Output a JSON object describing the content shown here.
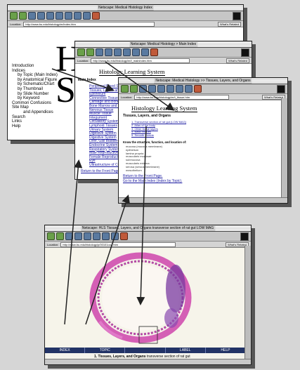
{
  "windows": {
    "index": {
      "title": "Netscape: Medical Histology Index",
      "location_label": "Location:",
      "url": "http://www.bu.edu/histology/m/index.htm",
      "whats_related": "What's Related",
      "big_letters": [
        "H",
        "S"
      ],
      "menu": [
        "Introduction",
        "Indices",
        "by Topic (Main Index)",
        "by Anatomical Figure",
        "by Schematic/Chart",
        "by Thumbnail",
        "by Slide Number",
        "by Keyword",
        "Common Confusions",
        "Site Map",
        "and Appendices",
        "Search",
        "Links",
        "Help"
      ]
    },
    "main_index": {
      "title": "Netscape: Medical Histology > Main Index",
      "location_label": "Location:",
      "url": "http://www.bu.edu/histology/m/t_mainindex.htm",
      "whats_related": "What's Related",
      "heading": "Histology Learning System",
      "subheading": "Main Index",
      "topics": [
        "Peripheral Blood Smear",
        "Tissues, Layers and Organs",
        "Epithelium",
        "Connective Tissue",
        "Cartilage and Bone",
        "Bone Marrow and Blood",
        "Nervous Tissue",
        "Muscle Tissue",
        "Integument",
        "Circulatory System",
        "Lymphoid Tissues",
        "Urinary System",
        "Digestive System",
        "Digestive System",
        "Liver, Gall Bladder",
        "Endocrine System",
        "Respiratory System",
        "Male Reproductive",
        "Female Reproductive",
        "Eye",
        "Ultrastructure of Cells"
      ],
      "return_link": "Return to the Front Page"
    },
    "tissues": {
      "title": "Netscape: Medical Histology >> Tissues, Layers, and Organs",
      "location_label": "Location:",
      "url": "http://www.bu.edu/histology/m/t_tissue.htm",
      "whats_related": "What's Related",
      "heading": "Histology Learning System",
      "subheading": "Tissues, Layers, and Organs",
      "list": [
        "1. Transverse section of rat gut (LOW MAG)",
        "2. Atlas of the body",
        "3. Other tissue layers",
        "4. Basic tissues",
        "5. Smooth muscle"
      ],
      "know_heading": "Know the structure, function, and location of:",
      "know_items": [
        "mucosa (mucous membrane)",
        "epithelium",
        "lamina propria",
        "muscularis mucosae",
        "submucosa",
        "muscularis externa",
        "serosa (serous membrane)",
        "mesothelium"
      ],
      "return_text": "Return to the Front Page.",
      "go_text": "Go to the Main Index (Index by Topic)."
    },
    "slide": {
      "title": "Netscape: HLS Tissues, Layers, and Organs transverse section of rat gut LOW MAG",
      "location_label": "Location:",
      "url": "http://www.bu.edu/histology/p/00101ooa.htm",
      "whats_related": "What's Related",
      "nav": [
        "INDEX",
        "TOPIC",
        "LABEL",
        "HELP"
      ],
      "caption_bold": "1. Tissues, Layers, and Organs",
      "caption_rest": "transverse section of rat gut"
    }
  },
  "colors": {
    "background": "#d6d6d6",
    "link": "#1a1aa0",
    "tissue_pink": "#e070c0",
    "tissue_purple": "#7a3aa0",
    "navbar": "#223366"
  }
}
